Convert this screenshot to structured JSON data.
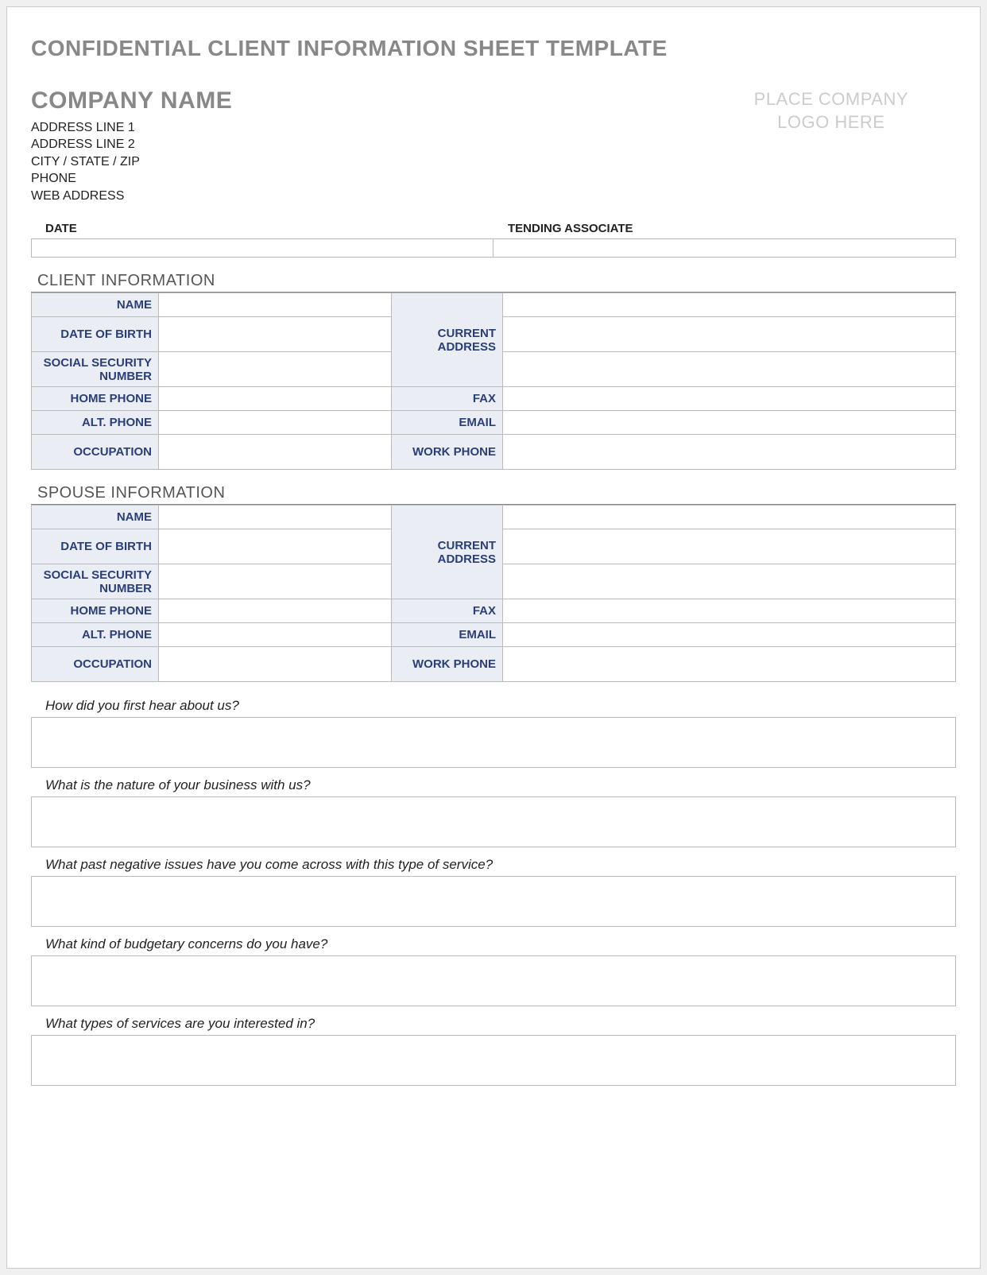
{
  "title": "CONFIDENTIAL CLIENT INFORMATION SHEET TEMPLATE",
  "company": {
    "name": "COMPANY NAME",
    "address1": "ADDRESS LINE 1",
    "address2": "ADDRESS LINE 2",
    "city_state_zip": "CITY / STATE / ZIP",
    "phone": "PHONE",
    "web": "WEB ADDRESS"
  },
  "logo_placeholder_line1": "PLACE COMPANY",
  "logo_placeholder_line2": "LOGO HERE",
  "date_label": "DATE",
  "associate_label": "TENDING ASSOCIATE",
  "sections": {
    "client": "CLIENT INFORMATION",
    "spouse": "SPOUSE INFORMATION"
  },
  "fields": {
    "name": "NAME",
    "dob": "DATE OF BIRTH",
    "ssn": "SOCIAL SECURITY NUMBER",
    "home_phone": "HOME PHONE",
    "alt_phone": "ALT. PHONE",
    "occupation": "OCCUPATION",
    "current_address": "CURRENT ADDRESS",
    "fax": "FAX",
    "email": "EMAIL",
    "work_phone": "WORK PHONE"
  },
  "questions": {
    "q1": "How did you first hear about us?",
    "q2": "What is the nature of your business with us?",
    "q3": "What past negative issues have you come across with this type of service?",
    "q4": "What kind of budgetary concerns do you have?",
    "q5": "What types of services are you interested in?"
  }
}
